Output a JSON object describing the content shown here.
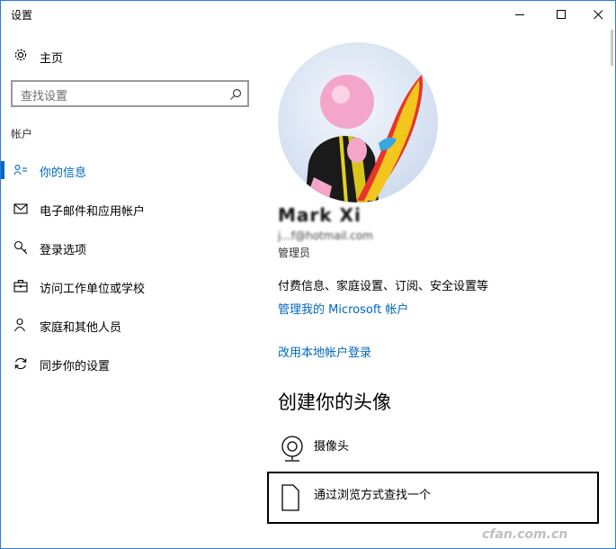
{
  "window": {
    "title": "设置",
    "controls": [
      "minimize-icon",
      "maximize-icon",
      "close-icon"
    ]
  },
  "sidebar": {
    "home_label": "主页",
    "home_icon": "gear-icon",
    "search_placeholder": "查找设置",
    "search_icon": "search-icon",
    "section_label": "帐户",
    "items": [
      {
        "label": "你的信息",
        "icon": "person-card-icon",
        "active": true
      },
      {
        "label": "电子邮件和应用帐户",
        "icon": "mail-icon",
        "active": false
      },
      {
        "label": "登录选项",
        "icon": "key-icon",
        "active": false
      },
      {
        "label": "访问工作单位或学校",
        "icon": "briefcase-icon",
        "active": false
      },
      {
        "label": "家庭和其他人员",
        "icon": "people-icon",
        "active": false
      },
      {
        "label": "同步你的设置",
        "icon": "sync-icon",
        "active": false
      }
    ]
  },
  "main": {
    "username": "Mark Xi",
    "email": "j...f@hotmail.com",
    "role": "管理员",
    "billing_text": "付费信息、家庭设置、订阅、安全设置等",
    "manage_link": "管理我的 Microsoft 帐户",
    "local_link": "改用本地帐户登录",
    "avatar_heading": "创建你的头像",
    "camera_label": "摄像头",
    "browse_label": "通过浏览方式查找一个"
  },
  "watermark": "cfan.com.cn",
  "accent_color": "#0067c0"
}
